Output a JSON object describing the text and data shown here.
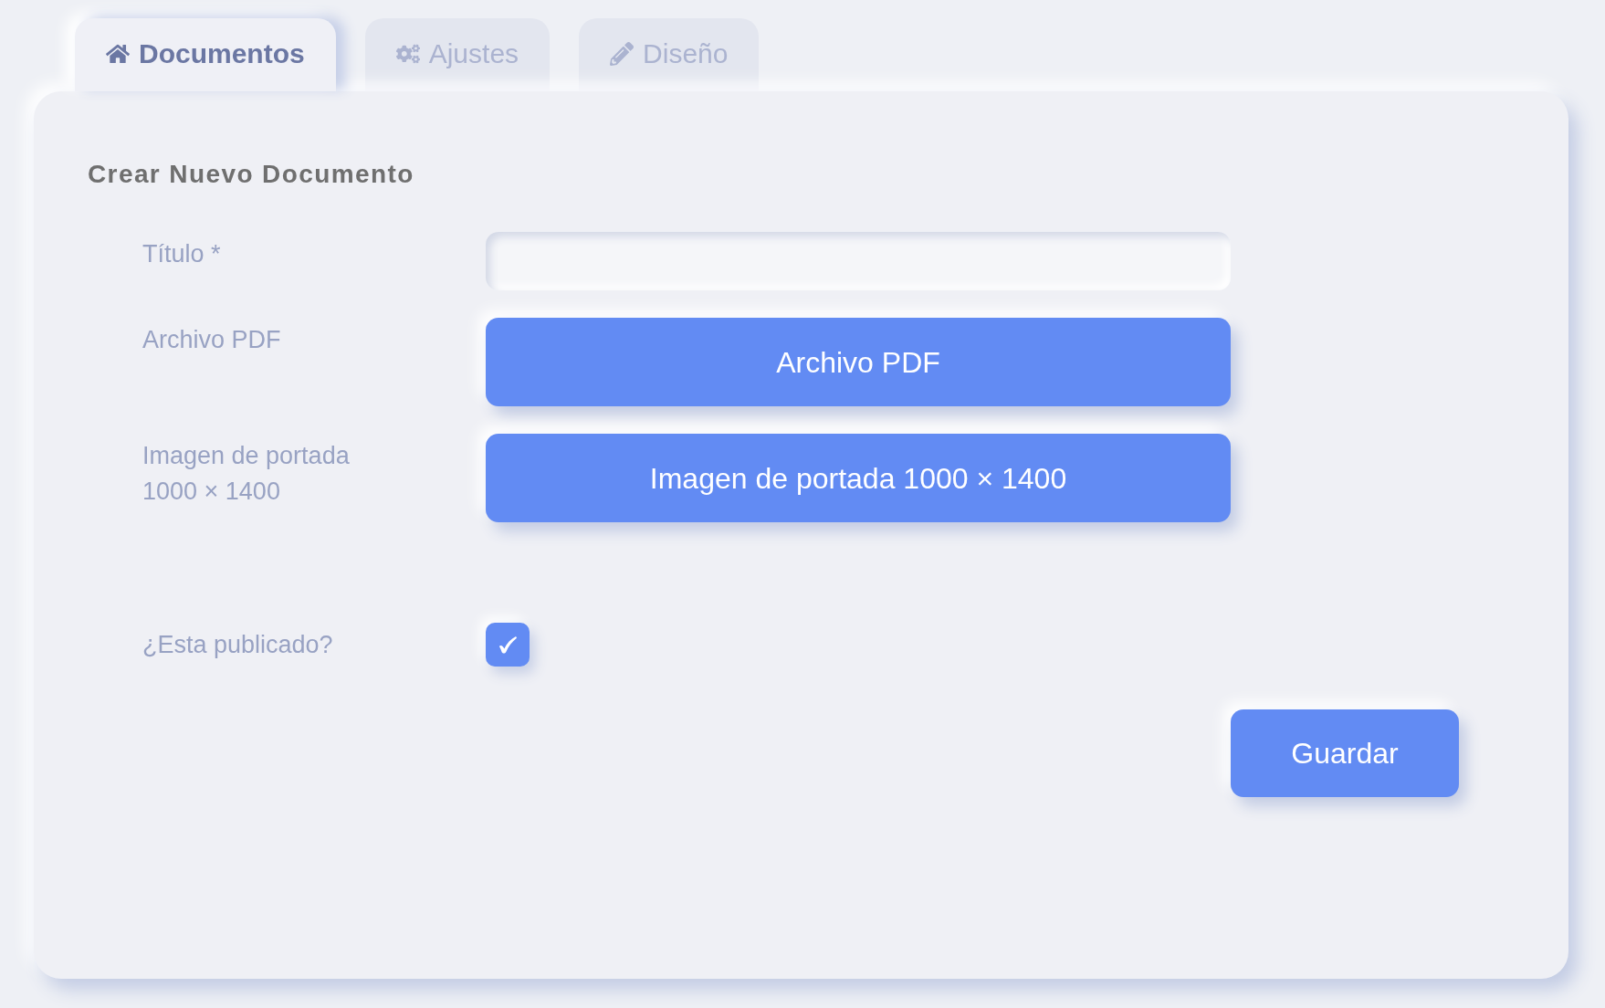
{
  "tabs": [
    {
      "label": "Documentos",
      "selected": true
    },
    {
      "label": "Ajustes",
      "selected": false
    },
    {
      "label": "Diseño",
      "selected": false
    }
  ],
  "form": {
    "heading": "Crear Nuevo Documento",
    "fields": [
      {
        "kind": "text",
        "label": "Título *"
      },
      {
        "kind": "file",
        "label": "Archivo PDF",
        "button": "Archivo PDF"
      },
      {
        "kind": "file",
        "label": "Imagen de portada 1000 × 1400",
        "button": "Imagen de portada 1000 × 1400"
      },
      {
        "kind": "checkbox",
        "label": "¿Esta publicado?",
        "checked": true
      }
    ],
    "submit": "Guardar"
  }
}
